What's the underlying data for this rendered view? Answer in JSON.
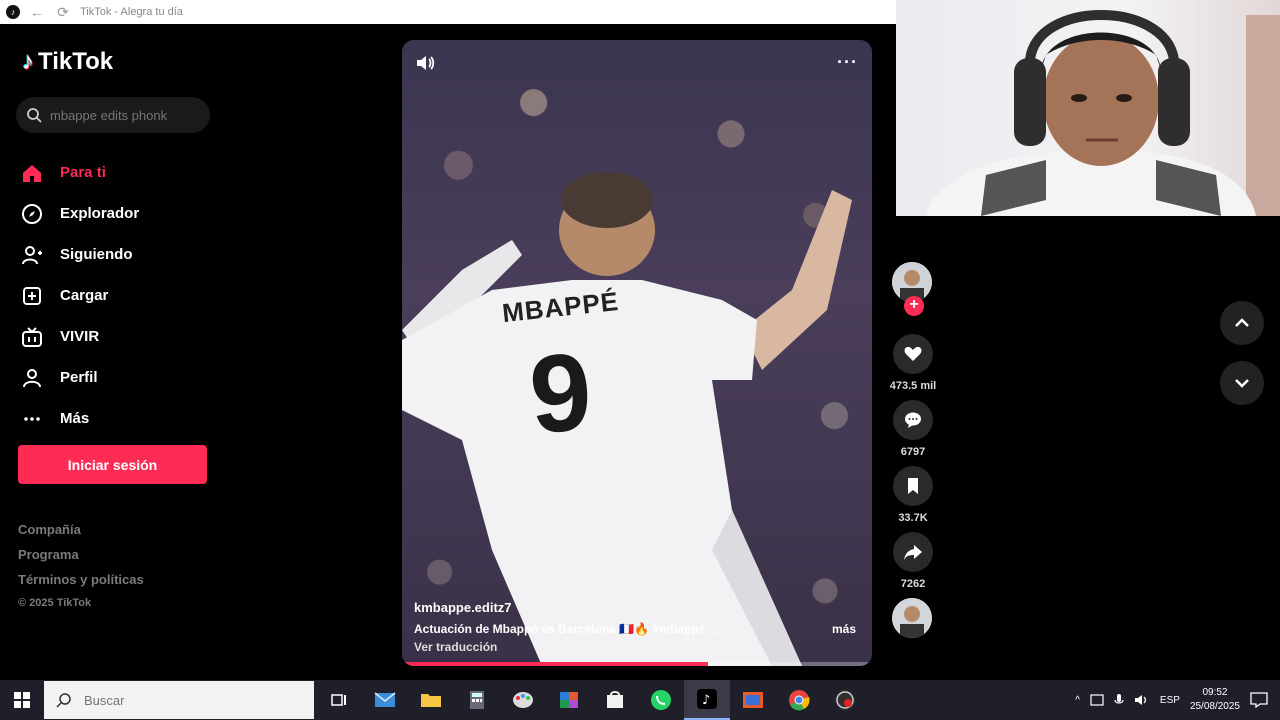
{
  "window": {
    "title": "TikTok - Alegra tu día"
  },
  "sidebar": {
    "logo_text": "TikTok",
    "search_placeholder": "mbappe edits phonk",
    "nav": [
      {
        "label": "Para ti",
        "icon": "home-icon",
        "active": true
      },
      {
        "label": "Explorador",
        "icon": "compass-icon",
        "active": false
      },
      {
        "label": "Siguiendo",
        "icon": "following-icon",
        "active": false
      },
      {
        "label": "Cargar",
        "icon": "upload-icon",
        "active": false
      },
      {
        "label": "VIVIR",
        "icon": "live-icon",
        "active": false
      },
      {
        "label": "Perfil",
        "icon": "profile-icon",
        "active": false
      },
      {
        "label": "Más",
        "icon": "more-icon",
        "active": false
      }
    ],
    "login_label": "Iniciar sesión",
    "footer": [
      "Compañía",
      "Programa",
      "Términos y políticas"
    ],
    "copyright": "© 2025 TikTok"
  },
  "video": {
    "username": "kmbappe.editz7",
    "caption": "Actuación de Mbappé vs Barcelona 🇫🇷🔥 #mbappé ...",
    "more_label": "más",
    "translate_label": "Ver traducción",
    "jersey_name": "MBAPPÉ",
    "jersey_number": "9",
    "progress": 0.65
  },
  "actions": {
    "likes": "473.5 mil",
    "comments": "6797",
    "saves": "33.7K",
    "shares": "7262"
  },
  "taskbar": {
    "search_placeholder": "Buscar",
    "language": "ESP",
    "time": "09:52",
    "date": "25/08/2025"
  },
  "colors": {
    "accent": "#fe2c55",
    "background": "#000000"
  }
}
